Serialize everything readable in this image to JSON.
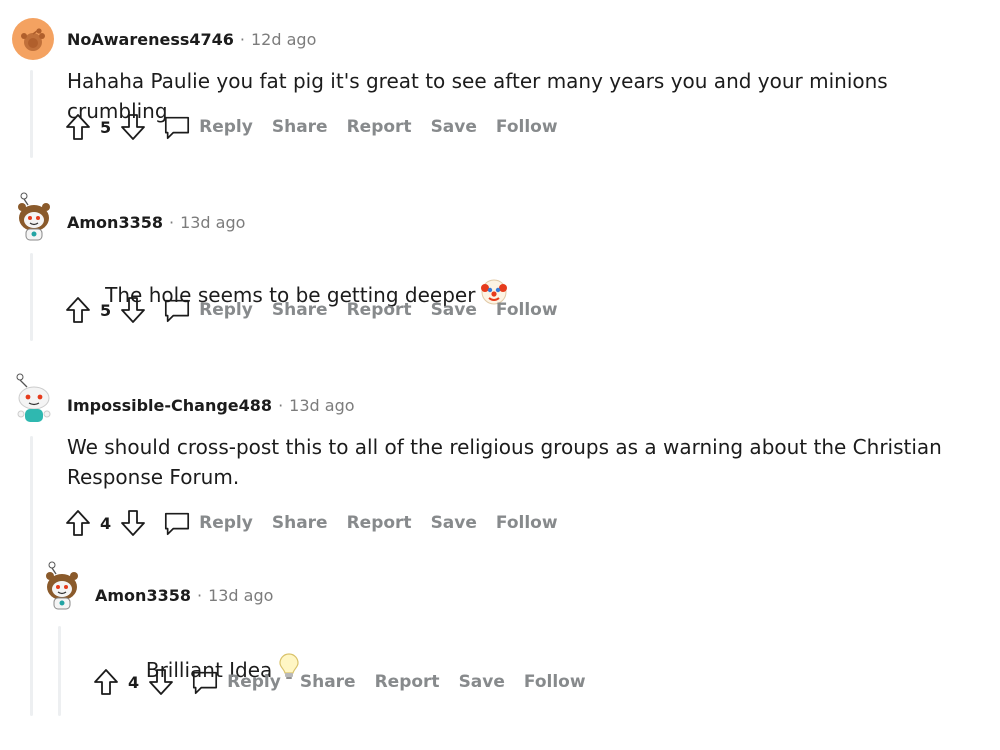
{
  "comments": [
    {
      "author": "NoAwareness4746",
      "separator": "·",
      "time": "12d ago",
      "text": "Hahaha Paulie you fat pig it's great to see after many years you and your minions crumbling",
      "score": "5",
      "avatar": "orange-snoo-avatar",
      "actions": {
        "reply": "Reply",
        "share": "Share",
        "report": "Report",
        "save": "Save",
        "follow": "Follow"
      }
    },
    {
      "author": "Amon3358",
      "separator": "·",
      "time": "13d ago",
      "text": "The hole seems to be getting deeper",
      "emoji": "clown-face-emoji",
      "score": "5",
      "avatar": "bear-costume-snoo-avatar",
      "actions": {
        "reply": "Reply",
        "share": "Share",
        "report": "Report",
        "save": "Save",
        "follow": "Follow"
      }
    },
    {
      "author": "Impossible-Change488",
      "separator": "·",
      "time": "13d ago",
      "text": "We should cross-post this to all of the religious groups as a warning about the Christian\nResponse Forum.",
      "score": "4",
      "avatar": "teal-shirt-snoo-avatar",
      "actions": {
        "reply": "Reply",
        "share": "Share",
        "report": "Report",
        "save": "Save",
        "follow": "Follow"
      }
    },
    {
      "author": "Amon3358",
      "separator": "·",
      "time": "13d ago",
      "text": "Brilliant Idea",
      "emoji": "light-bulb-emoji",
      "score": "4",
      "avatar": "bear-costume-snoo-avatar",
      "actions": {
        "reply": "Reply",
        "share": "Share",
        "report": "Report",
        "save": "Save",
        "follow": "Follow"
      }
    }
  ],
  "colors": {
    "meta_gray": "#7c7c7c",
    "action_gray": "#878a8c",
    "thread_line": "#edeff1",
    "text": "#1c1c1c"
  }
}
